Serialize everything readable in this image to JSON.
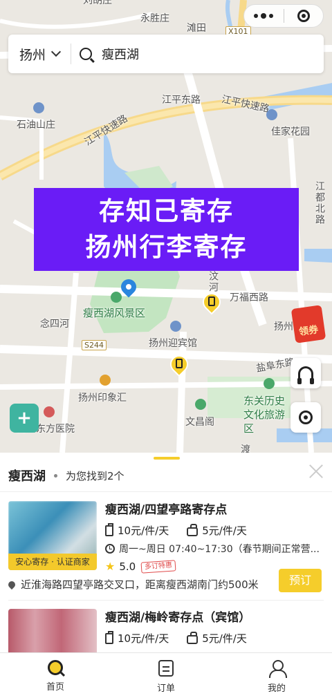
{
  "map": {
    "labels": {
      "top1": "刘胡庄",
      "yongsheng": "永胜庄",
      "tantian": "滩田",
      "x101": "X101",
      "jiangping_east": "江平东路",
      "jiangping_express_right": "江平快速路",
      "jiangping_express_left": "江平快速路",
      "shiyoushan": "石油山庄",
      "jiajia": "佳家花园",
      "jiangdu_north": "江都北路",
      "wanfu": "万福西路",
      "shouxihu": "瘦西湖风景区",
      "niansi": "念四河",
      "s244": "S244",
      "yingbin": "扬州迎宾馆",
      "yanfu": "盐阜东路",
      "yingxiang": "扬州印象汇",
      "dongfang": "扬州东方医院",
      "wenchang": "文昌阁",
      "dongguan": "东关历史文化旅游区",
      "yangzhou_r": "扬州",
      "wenhe": "汶河",
      "du": "渡"
    },
    "coupon_label": "领券"
  },
  "search": {
    "city": "扬州",
    "query": "瘦西湖"
  },
  "banner": {
    "line1": "存知己寄存",
    "line2": "扬州行李寄存"
  },
  "sheet": {
    "title": "瘦西湖",
    "count_text": "为您找到2个",
    "results": [
      {
        "name": "瘦西湖/四望亭路寄存点",
        "tag": "安心寄存 · 认证商家",
        "price_luggage": "10元/件/天",
        "price_bag": "5元/件/天",
        "hours": "周一~周日 07:40~17:30（春节期间正常营...",
        "rating": "5.0",
        "badge": "多订特惠",
        "address": "近淮海路四望亭路交叉口，距离瘦西湖南门约500米",
        "order_label": "预订"
      },
      {
        "name": "瘦西湖/梅岭寄存点（宾馆）",
        "price_luggage": "10元/件/天",
        "price_bag": "5元/件/天"
      }
    ]
  },
  "tabbar": {
    "home": "首页",
    "orders": "订单",
    "mine": "我的"
  },
  "colors": {
    "accent": "#f5cd2b",
    "banner": "#6a1cf6"
  }
}
